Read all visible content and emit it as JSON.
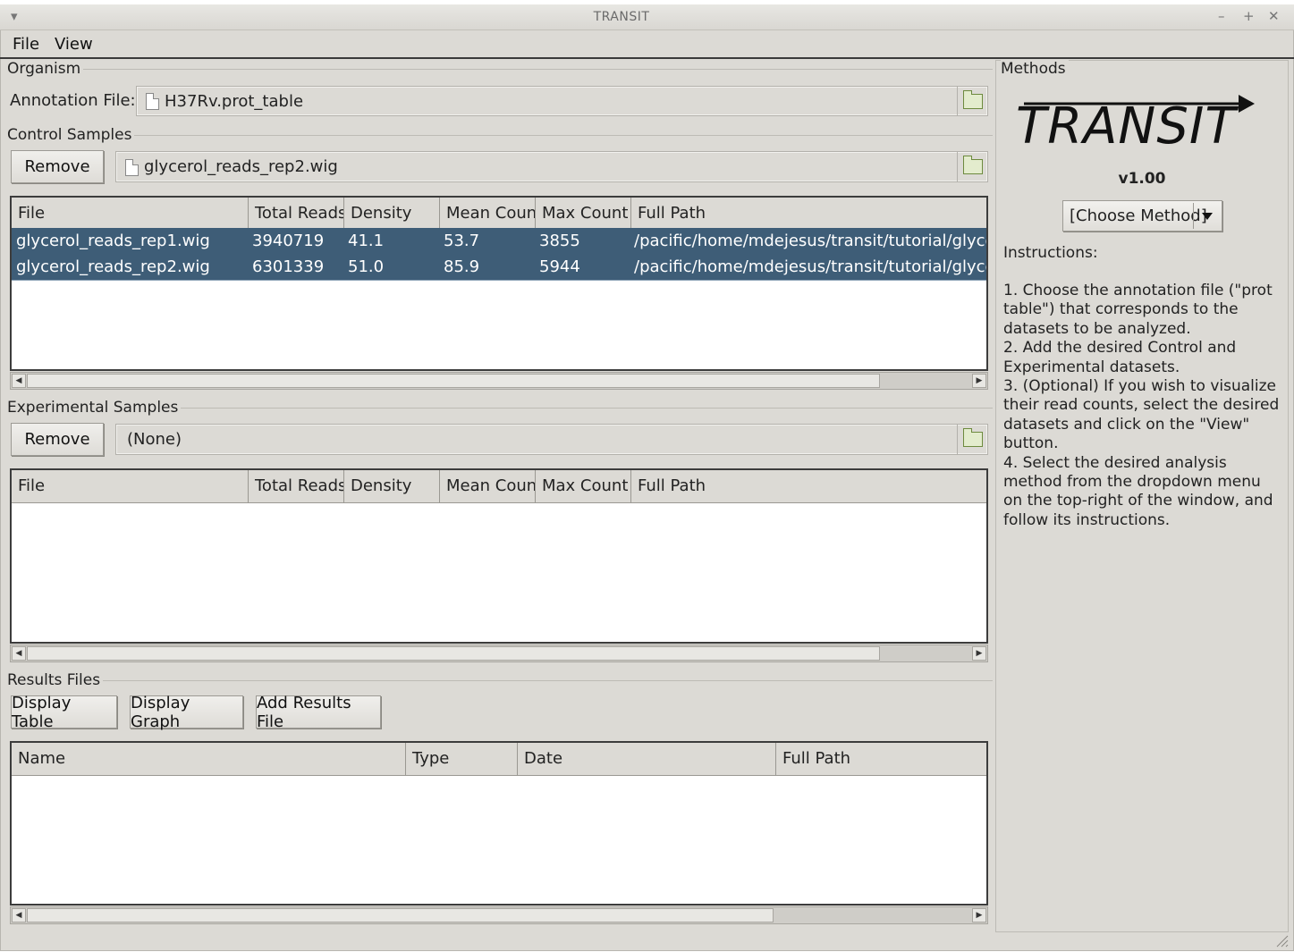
{
  "window": {
    "title": "TRANSIT",
    "menu_glyph": "▾",
    "controls": [
      "–",
      "+",
      "✕"
    ]
  },
  "menu": {
    "file": "File",
    "view": "View"
  },
  "organism": {
    "group_label": "Organism",
    "annotation_label": "Annotation File:",
    "annotation_value": "H37Rv.prot_table"
  },
  "control": {
    "group_label": "Control Samples",
    "remove_label": "Remove",
    "selected_file": "glycerol_reads_rep2.wig",
    "columns": [
      "File",
      "Total Reads",
      "Density",
      "Mean Count",
      "Max Count",
      "Full Path"
    ],
    "rows": [
      [
        "glycerol_reads_rep1.wig",
        "3940719",
        "41.1",
        "53.7",
        "3855",
        "/pacific/home/mdejesus/transit/tutorial/glycerol_"
      ],
      [
        "glycerol_reads_rep2.wig",
        "6301339",
        "51.0",
        "85.9",
        "5944",
        "/pacific/home/mdejesus/transit/tutorial/glycerol_"
      ]
    ]
  },
  "experimental": {
    "group_label": "Experimental Samples",
    "remove_label": "Remove",
    "selected_file": "(None)",
    "columns": [
      "File",
      "Total Reads",
      "Density",
      "Mean Count",
      "Max Count",
      "Full Path"
    ]
  },
  "results": {
    "group_label": "Results Files",
    "display_table": "Display Table",
    "display_graph": "Display Graph",
    "add_results": "Add Results File",
    "columns": [
      "Name",
      "Type",
      "Date",
      "Full Path"
    ]
  },
  "methods": {
    "group_label": "Methods",
    "logo_text": "TRANSIT",
    "version": "v1.00",
    "dropdown_value": "[Choose Method]",
    "instructions_title": "Instructions:",
    "instructions_body": "1. Choose the annotation file (\"prot table\") that corresponds to the datasets to be analyzed.\n2. Add the desired Control and Experimental datasets.\n3. (Optional) If you wish to visualize their read counts, select the desired datasets and click on the \"View\" button.\n4. Select the desired analysis method from the dropdown menu on the top-right of the window, and follow its instructions."
  },
  "colors": {
    "window_bg": "#dcdad5",
    "selection": "#3e5d77",
    "table_bg": "#ffffff"
  }
}
